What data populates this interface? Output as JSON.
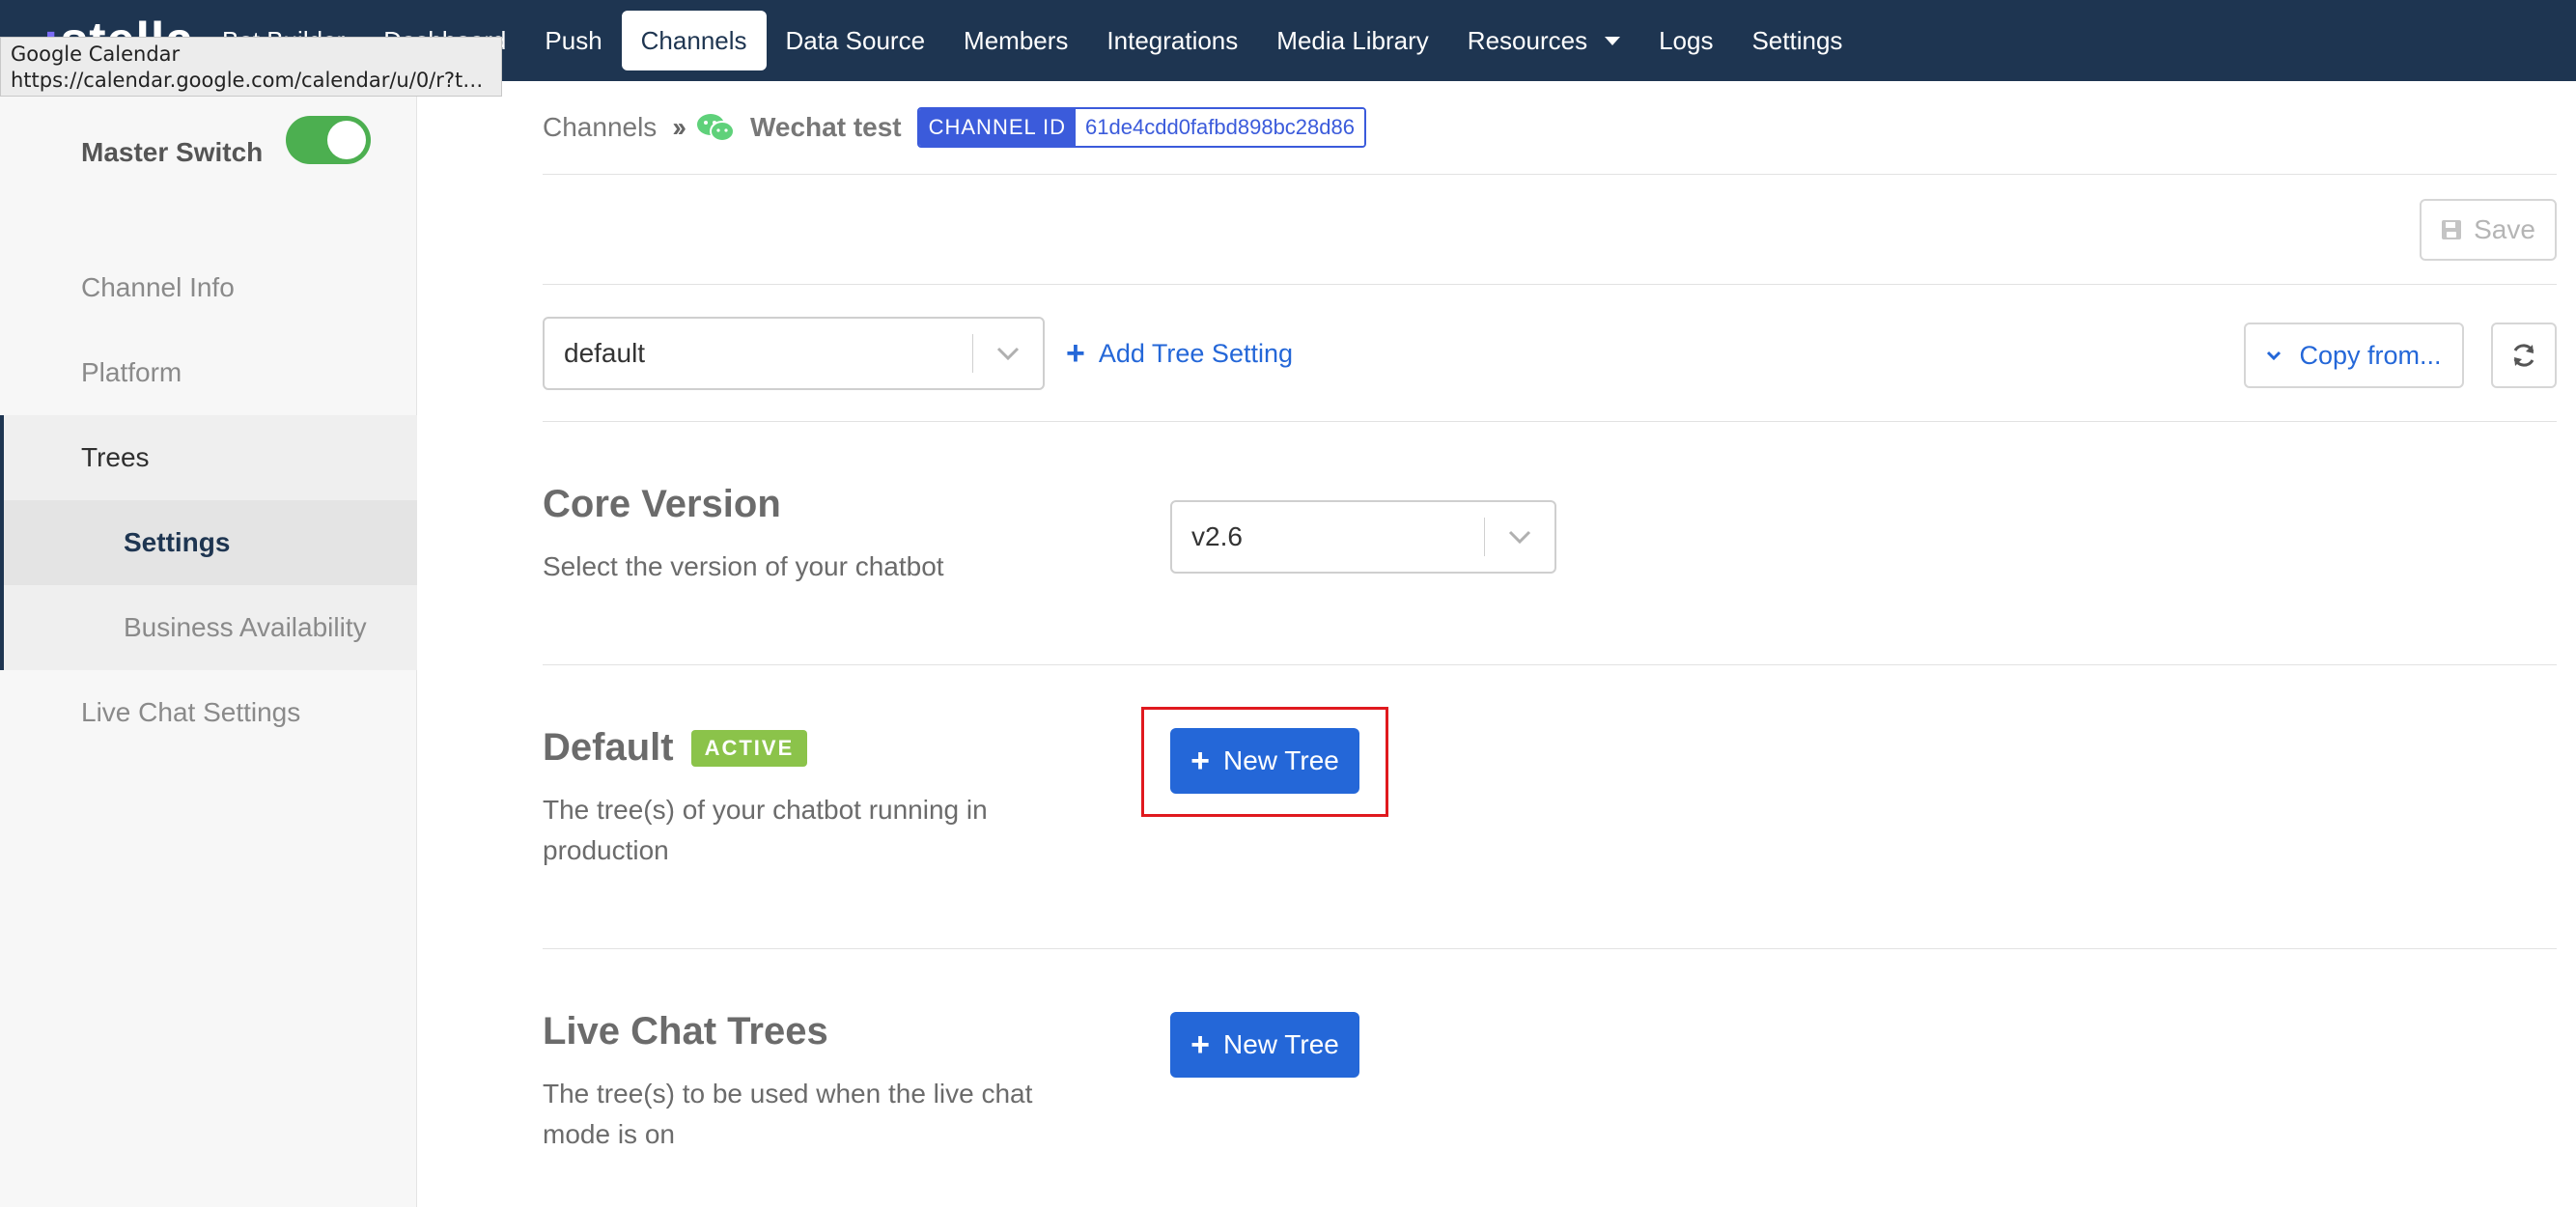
{
  "app": {
    "logo_text": "stella"
  },
  "nav": {
    "items": [
      {
        "label": "Bot Builder",
        "active": false
      },
      {
        "label": "Dashboard",
        "active": false
      },
      {
        "label": "Push",
        "active": false
      },
      {
        "label": "Channels",
        "active": true
      },
      {
        "label": "Data Source",
        "active": false
      },
      {
        "label": "Members",
        "active": false
      },
      {
        "label": "Integrations",
        "active": false
      },
      {
        "label": "Media Library",
        "active": false
      },
      {
        "label": "Resources",
        "active": false,
        "has_caret": true
      },
      {
        "label": "Logs",
        "active": false
      },
      {
        "label": "Settings",
        "active": false
      }
    ]
  },
  "tooltip": {
    "title": "Google Calendar",
    "url": "https://calendar.google.com/calendar/u/0/r?ta..."
  },
  "sidebar": {
    "master_switch_label": "Master Switch",
    "master_switch_on": true,
    "items": [
      {
        "label": "Channel Info"
      },
      {
        "label": "Platform"
      },
      {
        "label": "Trees"
      },
      {
        "label": "Settings"
      },
      {
        "label": "Business Availability"
      },
      {
        "label": "Live Chat Settings"
      }
    ]
  },
  "breadcrumb": {
    "root": "Channels",
    "channel_name": "Wechat test",
    "channel_id_label": "CHANNEL ID",
    "channel_id_value": "61de4cdd0fafbd898bc28d86"
  },
  "toolbar": {
    "save_label": "Save",
    "tree_setting_value": "default",
    "add_tree_setting_label": "Add Tree Setting",
    "copy_from_label": "Copy from..."
  },
  "core_version": {
    "title": "Core Version",
    "description": "Select the version of your chatbot",
    "value": "v2.6"
  },
  "default_section": {
    "title": "Default",
    "badge": "ACTIVE",
    "description": "The tree(s) of your chatbot running in production",
    "button_label": "New Tree"
  },
  "live_chat_section": {
    "title": "Live Chat Trees",
    "description": "The tree(s) to be used when the live chat mode is on",
    "button_label": "New Tree"
  },
  "colors": {
    "nav_bg": "#1e3551",
    "primary": "#2467d8",
    "toggle_on": "#4caf50",
    "active_badge": "#8bc34a",
    "channel_id": "#3b5bdb",
    "highlight": "#e0191e"
  }
}
